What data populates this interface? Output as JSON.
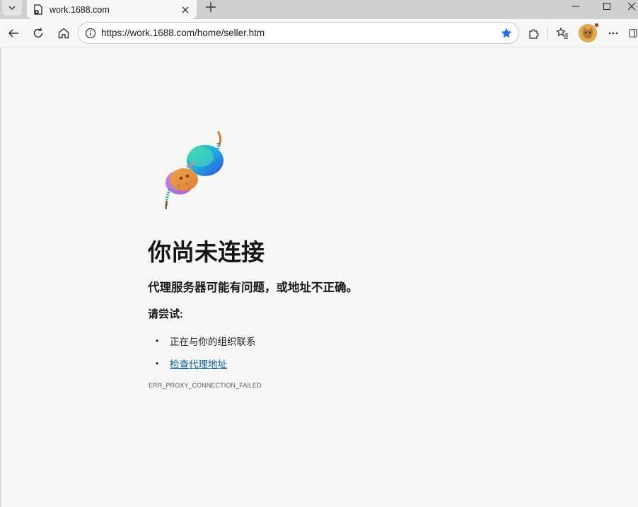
{
  "browser": {
    "tab": {
      "title": "work.1688.com"
    },
    "address_bar": {
      "url": "https://work.1688.com/home/seller.htm"
    },
    "colors": {
      "accent_star": "#1a73e8",
      "link": "#0b5cad"
    },
    "icons": {
      "tab_menu": "chevron-down-icon",
      "tab_favicon": "error-page-icon",
      "tab_close": "close-icon",
      "new_tab": "plus-icon",
      "back": "arrow-left-icon",
      "refresh": "refresh-icon",
      "home": "home-icon",
      "site_info": "info-icon",
      "favorite": "star-icon",
      "extensions": "puzzle-icon",
      "favorites": "favorites-list-icon",
      "profile": "avatar",
      "more": "more-icon"
    }
  },
  "error_page": {
    "heading": "你尚未连接",
    "subheading": "代理服务器可能有问题，或地址不正确。",
    "try_label": "请尝试:",
    "suggestions": [
      {
        "bullet": "•",
        "text": "正在与你的组织联系",
        "is_link": false
      },
      {
        "bullet": "•",
        "text": "检查代理地址",
        "is_link": true
      }
    ],
    "error_code": "ERR_PROXY_CONNECTION_FAILED"
  }
}
